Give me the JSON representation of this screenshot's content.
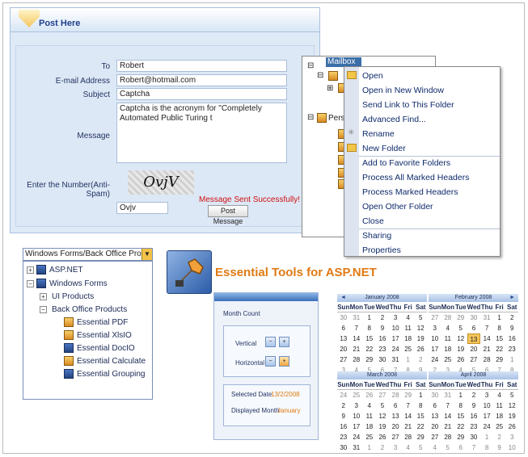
{
  "post": {
    "title": "Post Here",
    "labels": {
      "to": "To",
      "email": "E-mail Address",
      "subject": "Subject",
      "message": "Message",
      "antispam": "Enter the Number(Anti-Spam)"
    },
    "values": {
      "to": "Robert",
      "email": "Robert@hotmail.com",
      "subject": "Captcha",
      "message": "Captcha is the acronym for \"Completely Automated Public Turing t",
      "captcha_input": "Ovjv"
    },
    "captcha_image_text": "OvjV",
    "status": "Message Sent Successfully!",
    "button": "Post Message"
  },
  "mailbox": {
    "root": "Mailbox",
    "personal": "Perso"
  },
  "context_menu": {
    "items": [
      "Open",
      "Open in New Window",
      "Send Link to This Folder",
      "Advanced Find...",
      "Rename",
      "New Folder",
      "Add to Favorite Folders",
      "Process All Marked Headers",
      "Process Marked Headers",
      "Open Other Folder",
      "Close",
      "Sharing",
      "Properties"
    ]
  },
  "wftree": {
    "combo": "Windows Forms/Back Office Prod",
    "nodes": [
      "ASP.NET",
      "Windows Forms",
      "UI Products",
      "Back Office Products",
      "Essential PDF",
      "Essential XlsIO",
      "Essential DocIO",
      "Essential Calculate",
      "Essential Grouping"
    ]
  },
  "essential": {
    "title": "Essential Tools for ASP.NET"
  },
  "month_count": {
    "title": "Month Count",
    "vertical": "Vertical",
    "horizontal": "Horizontal",
    "selected_date_label": "Selected Date",
    "selected_date_value": "13/2/2008",
    "displayed_month_label": "Displayed Month",
    "displayed_month_value": "January"
  },
  "calendars": [
    {
      "title": "January 2008",
      "weeks": [
        [
          "30",
          "31",
          "1",
          "2",
          "3",
          "4",
          "5"
        ],
        [
          "6",
          "7",
          "8",
          "9",
          "10",
          "11",
          "12"
        ],
        [
          "13",
          "14",
          "15",
          "16",
          "17",
          "18",
          "19"
        ],
        [
          "20",
          "21",
          "22",
          "23",
          "24",
          "25",
          "26"
        ],
        [
          "27",
          "28",
          "29",
          "30",
          "31",
          "1",
          "2"
        ],
        [
          "3",
          "4",
          "5",
          "6",
          "7",
          "8",
          "9"
        ]
      ]
    },
    {
      "title": "February 2008",
      "weeks": [
        [
          "27",
          "28",
          "29",
          "30",
          "31",
          "1",
          "2"
        ],
        [
          "3",
          "4",
          "5",
          "6",
          "7",
          "8",
          "9"
        ],
        [
          "10",
          "11",
          "12",
          "13",
          "14",
          "15",
          "16"
        ],
        [
          "17",
          "18",
          "19",
          "20",
          "21",
          "22",
          "23"
        ],
        [
          "24",
          "25",
          "26",
          "27",
          "28",
          "29",
          "1"
        ],
        [
          "2",
          "3",
          "4",
          "5",
          "6",
          "7",
          "8"
        ]
      ]
    },
    {
      "title": "March 2008",
      "weeks": [
        [
          "24",
          "25",
          "26",
          "27",
          "28",
          "29",
          "1"
        ],
        [
          "2",
          "3",
          "4",
          "5",
          "6",
          "7",
          "8"
        ],
        [
          "9",
          "10",
          "11",
          "12",
          "13",
          "14",
          "15"
        ],
        [
          "16",
          "17",
          "18",
          "19",
          "20",
          "21",
          "22"
        ],
        [
          "23",
          "24",
          "25",
          "26",
          "27",
          "28",
          "29"
        ],
        [
          "30",
          "31",
          "1",
          "2",
          "3",
          "4",
          "5"
        ]
      ]
    },
    {
      "title": "April 2008",
      "weeks": [
        [
          "30",
          "31",
          "1",
          "2",
          "3",
          "4",
          "5"
        ],
        [
          "6",
          "7",
          "8",
          "9",
          "10",
          "11",
          "12"
        ],
        [
          "13",
          "14",
          "15",
          "16",
          "17",
          "18",
          "19"
        ],
        [
          "20",
          "21",
          "22",
          "23",
          "24",
          "25",
          "26"
        ],
        [
          "27",
          "28",
          "29",
          "30",
          "1",
          "2",
          "3"
        ],
        [
          "4",
          "5",
          "6",
          "7",
          "8",
          "9",
          "10"
        ]
      ]
    }
  ],
  "weekdays": [
    "Sun",
    "Mon",
    "Tue",
    "Wed",
    "Thu",
    "Fri",
    "Sat"
  ],
  "colors": {
    "accent": "#e07a14",
    "link": "#1d3f8a",
    "error": "#d01010"
  }
}
